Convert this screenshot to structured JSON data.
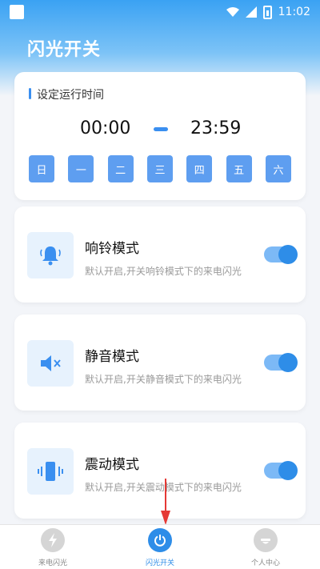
{
  "status_bar": {
    "time": "11:02"
  },
  "header": {
    "title": "闪光开关"
  },
  "schedule": {
    "title": "设定运行时间",
    "start_time": "00:00",
    "end_time": "23:59",
    "days": [
      "日",
      "一",
      "二",
      "三",
      "四",
      "五",
      "六"
    ]
  },
  "modes": [
    {
      "title": "响铃模式",
      "description": "默认开启,开关响铃模式下的来电闪光",
      "icon": "bell-icon",
      "enabled": true
    },
    {
      "title": "静音模式",
      "description": "默认开启,开关静音模式下的来电闪光",
      "icon": "mute-speaker-icon",
      "enabled": true
    },
    {
      "title": "震动模式",
      "description": "默认开启,开关震动模式下的来电闪光",
      "icon": "vibrate-phone-icon",
      "enabled": true
    }
  ],
  "tabbar": {
    "tabs": [
      {
        "label": "来电闪光",
        "icon": "flash-icon",
        "active": false
      },
      {
        "label": "闪光开关",
        "icon": "power-icon",
        "active": true
      },
      {
        "label": "个人中心",
        "icon": "user-icon",
        "active": false
      }
    ]
  },
  "colors": {
    "accent": "#2e8de8",
    "header_gradient_top": "#3aa2f3",
    "background": "#f3f5f9",
    "annotation_arrow": "#e53935"
  }
}
